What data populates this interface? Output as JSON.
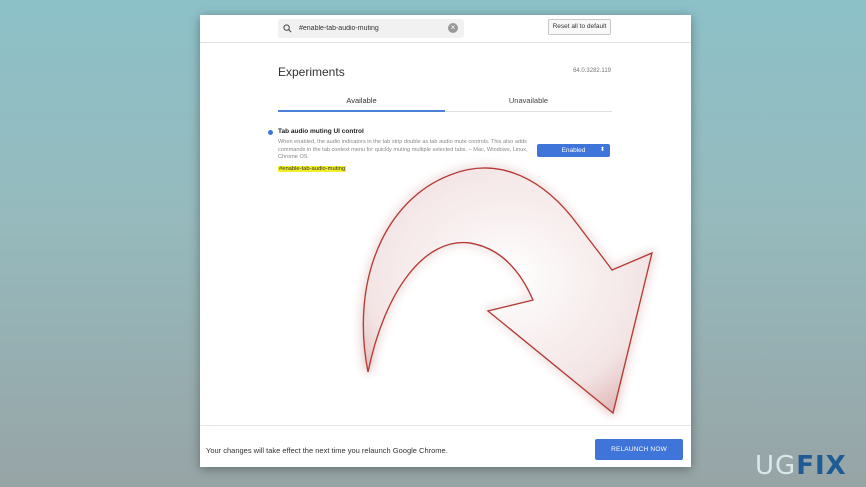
{
  "search": {
    "value": "#enable-tab-audio-muting"
  },
  "toolbar": {
    "reset_label": "Reset all to default"
  },
  "header": {
    "title": "Experiments",
    "version": "64.0.3282.119"
  },
  "tabs": [
    {
      "label": "Available",
      "active": true
    },
    {
      "label": "Unavailable",
      "active": false
    }
  ],
  "experiment": {
    "title": "Tab audio muting UI control",
    "description": "When enabled, the audio indicators in the tab strip double as tab audio mute controls. This also adds commands in the tab context menu for quickly muting multiple selected tabs. – Mac, Windows, Linux, Chrome OS",
    "tag": "#enable-tab-audio-muting",
    "selected_option": "Enabled"
  },
  "footer": {
    "message": "Your changes will take effect the next time you relaunch Google Chrome.",
    "relaunch_label": "RELAUNCH NOW"
  },
  "watermark": {
    "part1": "UG",
    "part2": "FIX"
  },
  "colors": {
    "accent": "#3f74d8",
    "highlight": "#f2ee2a",
    "arrow": "#c0504d"
  },
  "icons": [
    "search-icon",
    "clear-icon",
    "dropdown-chevron-icon",
    "curved-arrow-icon"
  ]
}
